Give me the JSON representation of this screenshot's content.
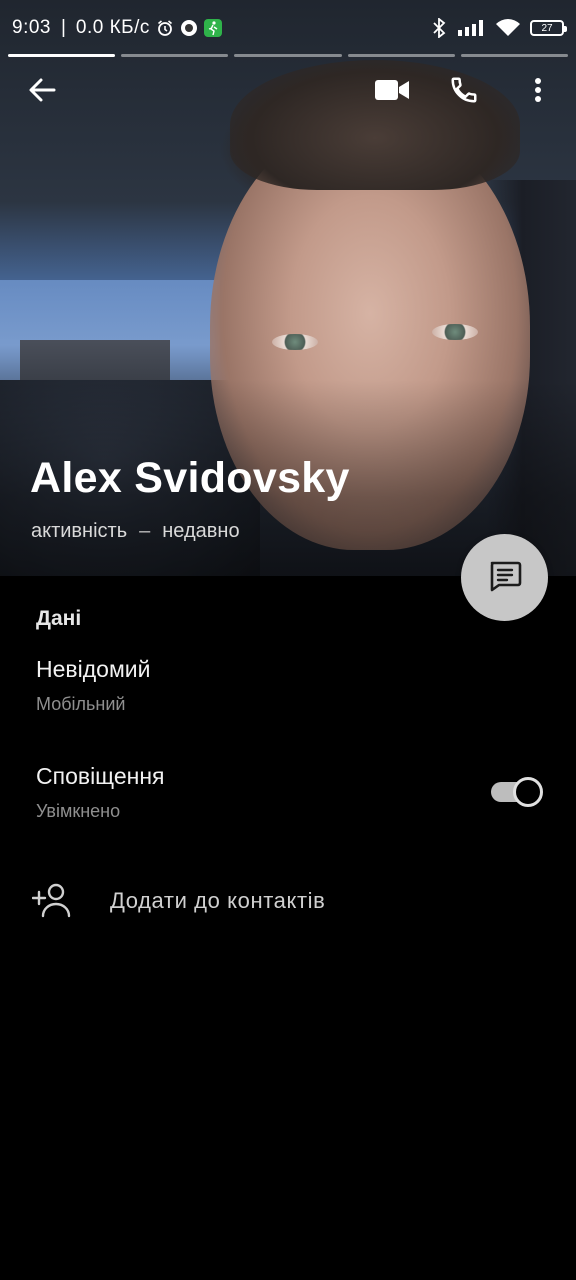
{
  "status_bar": {
    "time": "9:03",
    "separator": "|",
    "network_speed": "0.0 КБ/с",
    "battery": "27",
    "icons_left": [
      "alarm-icon",
      "app-icon",
      "fitness-icon"
    ],
    "icons_right": [
      "bluetooth-icon",
      "signal-icon",
      "wifi-icon",
      "battery-icon"
    ]
  },
  "toolbar": {
    "back_icon": "arrow-left-icon",
    "video_icon": "video-call-icon",
    "call_icon": "phone-icon",
    "more_icon": "more-vert-icon"
  },
  "profile": {
    "name": "Alex Svidovsky",
    "presence_label": "активність",
    "presence_dash": "–",
    "presence_value": "недавно"
  },
  "fab": {
    "icon": "message-icon"
  },
  "details": {
    "section_title": "Дані",
    "phone_value": "Невідомий",
    "phone_type": "Мобільний",
    "notifications_label": "Сповіщення",
    "notifications_state": "Увімкнено",
    "notifications_on": true,
    "add_contact_label": "Додати до контактів"
  },
  "colors": {
    "background": "#000000",
    "fab_bg": "#c7c7c7",
    "secondary_text": "#8f8f8f"
  }
}
